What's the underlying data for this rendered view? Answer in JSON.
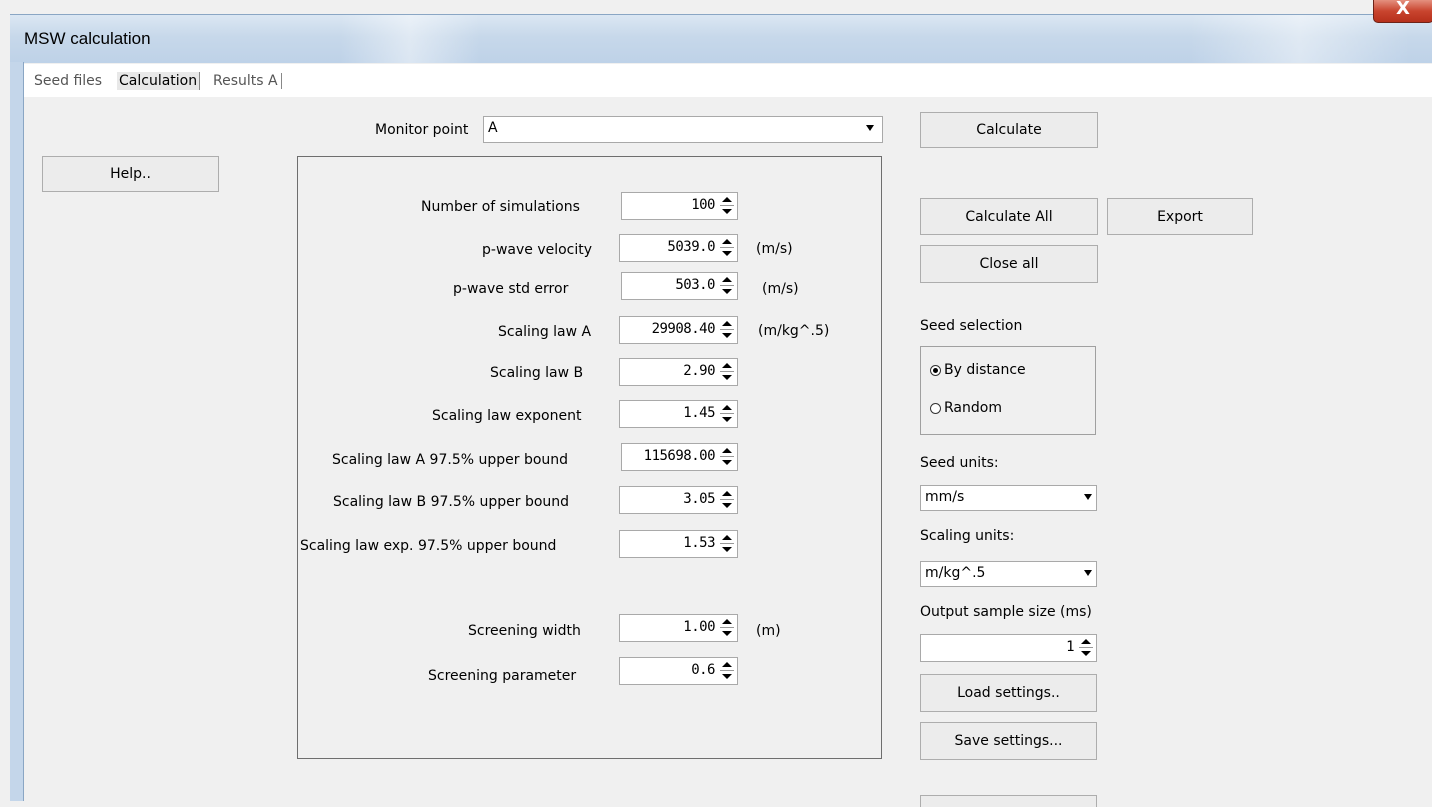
{
  "window": {
    "title": "MSW calculation",
    "close_glyph": "X"
  },
  "tabs": [
    {
      "label": "Seed files",
      "active": false
    },
    {
      "label": "Calculation",
      "active": true
    },
    {
      "label": "Results A",
      "active": false
    }
  ],
  "monitor": {
    "label": "Monitor point",
    "value": "A"
  },
  "buttons": {
    "help": "Help..",
    "calculate": "Calculate",
    "calculate_all": "Calculate All",
    "export": "Export",
    "close_all": "Close all",
    "load_settings": "Load settings..",
    "save_settings": "Save settings..."
  },
  "params": [
    {
      "label": "Number of simulations",
      "value": "100",
      "unit": ""
    },
    {
      "label": "p-wave velocity",
      "value": "5039.0",
      "unit": "(m/s)"
    },
    {
      "label": "p-wave std error",
      "value": "503.0",
      "unit": "(m/s)"
    },
    {
      "label": "Scaling law A",
      "value": "29908.40",
      "unit": "(m/kg^.5)"
    },
    {
      "label": "Scaling law B",
      "value": "2.90",
      "unit": ""
    },
    {
      "label": "Scaling law exponent",
      "value": "1.45",
      "unit": ""
    },
    {
      "label": "Scaling law A 97.5% upper bound",
      "value": "115698.00",
      "unit": ""
    },
    {
      "label": "Scaling law B 97.5% upper bound",
      "value": "3.05",
      "unit": ""
    },
    {
      "label": "Scaling law exp. 97.5% upper bound",
      "value": "1.53",
      "unit": ""
    },
    {
      "label": "Screening width",
      "value": "1.00",
      "unit": "(m)"
    },
    {
      "label": "Screening parameter",
      "value": "0.6",
      "unit": ""
    }
  ],
  "seed_selection": {
    "label": "Seed selection",
    "options": [
      {
        "label": "By distance",
        "selected": true
      },
      {
        "label": "Random",
        "selected": false
      }
    ]
  },
  "seed_units": {
    "label": "Seed units:",
    "value": "mm/s"
  },
  "scaling_units": {
    "label": "Scaling units:",
    "value": "m/kg^.5"
  },
  "output_sample": {
    "label": "Output sample size (ms)",
    "value": "1"
  }
}
